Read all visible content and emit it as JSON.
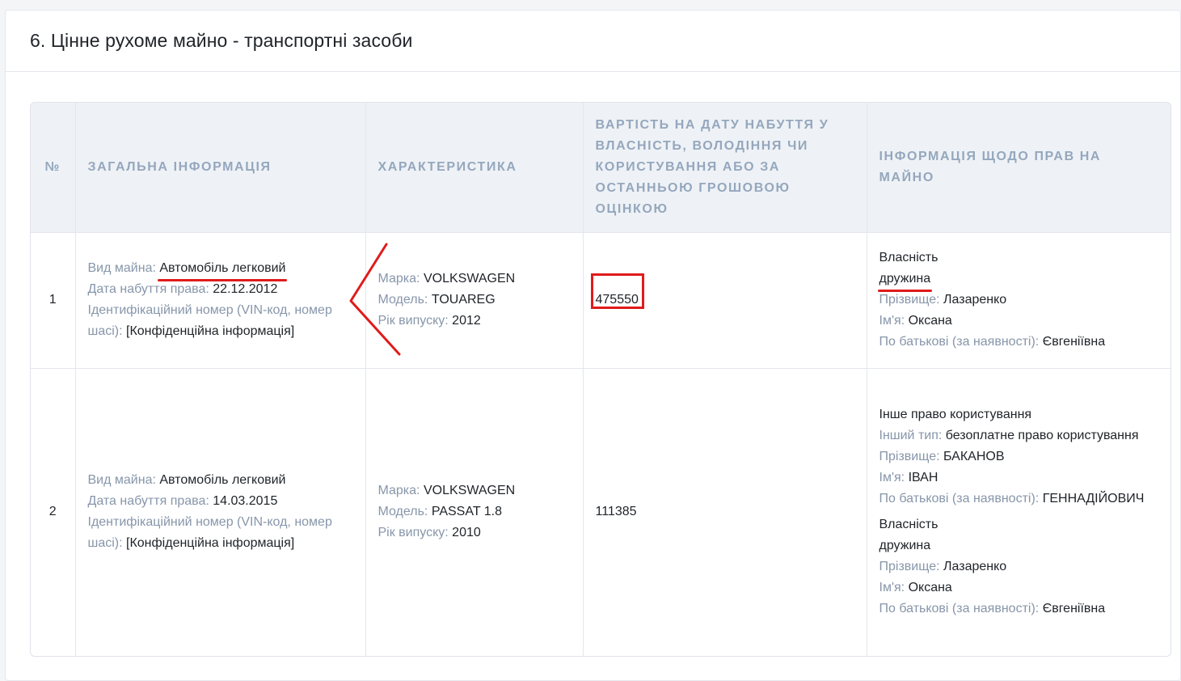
{
  "section": {
    "title": "6. Цінне рухоме майно - транспортні засоби"
  },
  "table": {
    "headers": {
      "num": "№",
      "general": "Загальна інформація",
      "characteristics": "Характеристика",
      "value": "Вартість на дату набуття у власність, володіння чи користування або за останньою грошовою оцінкою",
      "rights": "Інформація щодо прав на майно"
    },
    "labels": {
      "kind": "Вид майна:",
      "acq_date": "Дата набуття права:",
      "vin": "Ідентифікаційний номер (VIN-код, номер шасі):",
      "brand": "Марка:",
      "model": "Модель:",
      "year": "Рік випуску:",
      "other_type": "Інший тип:",
      "surname": "Прізвище:",
      "name": "Ім'я:",
      "patronymic": "По батькові (за наявності):"
    },
    "rows": [
      {
        "num": "1",
        "kind": "Автомобіль легковий",
        "acq_date": "22.12.2012",
        "vin": "[Конфіденційна інформація]",
        "brand": "VOLKSWAGEN",
        "model": "TOUAREG",
        "year": "2012",
        "value": "475550",
        "rights": [
          {
            "type": "Власність",
            "relation": "дружина",
            "surname": "Лазаренко",
            "name": "Оксана",
            "patronymic": "Євгеніївна"
          }
        ]
      },
      {
        "num": "2",
        "kind": "Автомобіль легковий",
        "acq_date": "14.03.2015",
        "vin": "[Конфіденційна інформація]",
        "brand": "VOLKSWAGEN",
        "model": "PASSAT 1.8",
        "year": "2010",
        "value": "111385",
        "rights": [
          {
            "type": "Інше право користування",
            "other_type": "безоплатне право користування",
            "surname": "БАКАНОВ",
            "name": "ІВАН",
            "patronymic": "ГЕННАДІЙОВИЧ"
          },
          {
            "type": "Власність",
            "relation": "дружина",
            "surname": "Лазаренко",
            "name": "Оксана",
            "patronymic": "Євгеніївна"
          }
        ]
      }
    ]
  },
  "colors": {
    "header_bg": "#eef2f6",
    "header_text": "#95a7bd",
    "label_text": "#8796aa",
    "annotation_red": "#e01b1b"
  }
}
